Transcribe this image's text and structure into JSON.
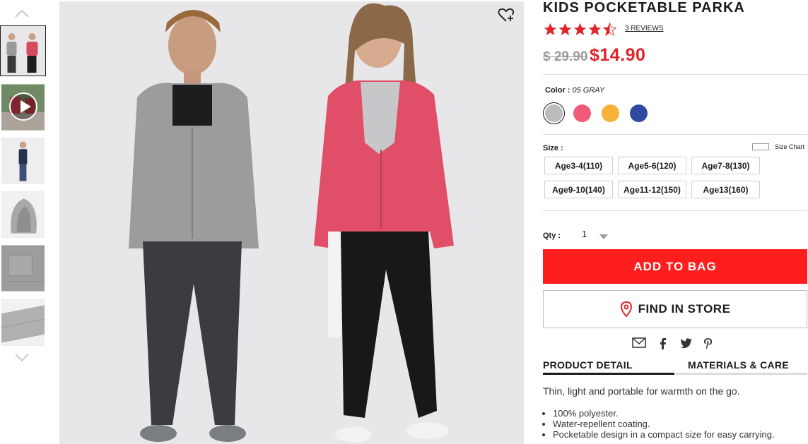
{
  "product": {
    "title": "KIDS POCKETABLE PARKA",
    "rating": 4.5,
    "reviews": "3 REVIEWS",
    "old_price": "$ 29.90",
    "new_price": "$14.90",
    "wishlist_icon": "heart-plus-icon"
  },
  "gallery": {
    "thumbnails": [
      "kids-front",
      "video",
      "boy-side",
      "hood-detail",
      "back-detail",
      "sleeve-detail"
    ],
    "selected_index": 0
  },
  "color": {
    "label": "Color :",
    "value": "05 GRAY",
    "swatches": [
      "#bdbcbc",
      "#f05c78",
      "#f7b23b",
      "#2f4a9e"
    ]
  },
  "size": {
    "label": "Size :",
    "chart_label": "Size Chart",
    "options": [
      "Age3-4(110)",
      "Age5-6(120)",
      "Age7-8(130)",
      "Age9-10(140)",
      "Age11-12(150)",
      "Age13(160)"
    ]
  },
  "quantity": {
    "label": "Qty :",
    "value": "1"
  },
  "actions": {
    "add_to_bag": "ADD TO BAG",
    "find_in_store": "FIND IN STORE"
  },
  "share_icons": [
    "email-icon",
    "facebook-icon",
    "twitter-icon",
    "pinterest-icon"
  ],
  "tabs": [
    "PRODUCT DETAIL",
    "MATERIALS & CARE"
  ],
  "detail": {
    "description": "Thin, light and portable for warmth on the go.",
    "bullets": [
      "100% polyester.",
      "Water-repellent coating.",
      "Pocketable design in a compact size for easy carrying."
    ]
  },
  "colors": {
    "accent": "#ff1e1e",
    "price_red": "#e0242a"
  }
}
